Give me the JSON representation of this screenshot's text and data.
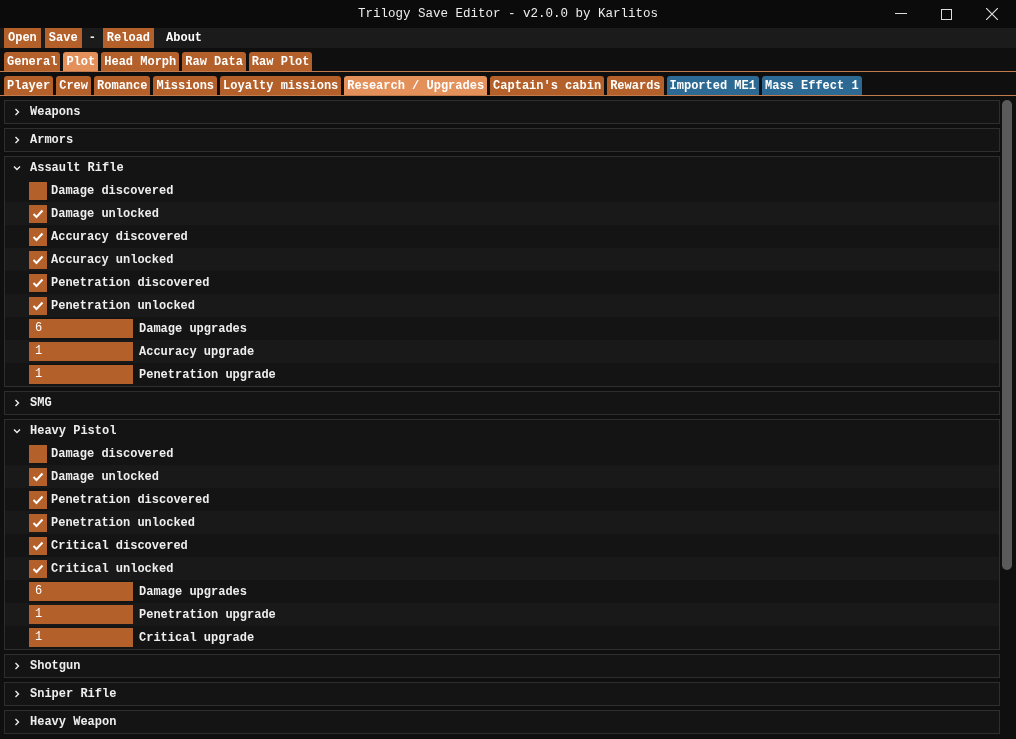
{
  "window": {
    "title": "Trilogy Save Editor - v2.0.0 by Karlitos"
  },
  "menu": [
    {
      "label": "Open",
      "kind": "button"
    },
    {
      "label": "Save",
      "kind": "button"
    },
    {
      "label": "-",
      "kind": "text"
    },
    {
      "label": "Reload",
      "kind": "button"
    },
    {
      "label": "About",
      "kind": "link"
    }
  ],
  "tabs": [
    {
      "label": "General",
      "selected": false
    },
    {
      "label": "Plot",
      "selected": true
    },
    {
      "label": "Head Morph",
      "selected": false
    },
    {
      "label": "Raw Data",
      "selected": false
    },
    {
      "label": "Raw Plot",
      "selected": false
    }
  ],
  "subtabs": [
    {
      "label": "Player",
      "selected": false,
      "kind": "me2"
    },
    {
      "label": "Crew",
      "selected": false,
      "kind": "me2"
    },
    {
      "label": "Romance",
      "selected": false,
      "kind": "me2"
    },
    {
      "label": "Missions",
      "selected": false,
      "kind": "me2"
    },
    {
      "label": "Loyalty missions",
      "selected": false,
      "kind": "me2"
    },
    {
      "label": "Research / Upgrades",
      "selected": true,
      "kind": "me2"
    },
    {
      "label": "Captain's cabin",
      "selected": false,
      "kind": "me2"
    },
    {
      "label": "Rewards",
      "selected": false,
      "kind": "me2"
    },
    {
      "label": "Imported ME1",
      "selected": false,
      "kind": "me1"
    },
    {
      "label": "Mass Effect 1",
      "selected": false,
      "kind": "me1"
    }
  ],
  "sections": [
    {
      "title": "Weapons",
      "expanded": false
    },
    {
      "title": "Armors",
      "expanded": false
    },
    {
      "title": "Assault Rifle",
      "expanded": true,
      "items": [
        {
          "kind": "checkbox",
          "label": "Damage discovered",
          "checked": false
        },
        {
          "kind": "checkbox",
          "label": "Damage unlocked",
          "checked": true
        },
        {
          "kind": "checkbox",
          "label": "Accuracy discovered",
          "checked": true
        },
        {
          "kind": "checkbox",
          "label": "Accuracy unlocked",
          "checked": true
        },
        {
          "kind": "checkbox",
          "label": "Penetration discovered",
          "checked": true
        },
        {
          "kind": "checkbox",
          "label": "Penetration unlocked",
          "checked": true
        },
        {
          "kind": "number",
          "label": "Damage upgrades",
          "amount": "6"
        },
        {
          "kind": "number",
          "label": "Accuracy upgrade",
          "amount": "1"
        },
        {
          "kind": "number",
          "label": "Penetration upgrade",
          "amount": "1"
        }
      ]
    },
    {
      "title": "SMG",
      "expanded": false
    },
    {
      "title": "Heavy Pistol",
      "expanded": true,
      "items": [
        {
          "kind": "checkbox",
          "label": "Damage discovered",
          "checked": false
        },
        {
          "kind": "checkbox",
          "label": "Damage unlocked",
          "checked": true
        },
        {
          "kind": "checkbox",
          "label": "Penetration discovered",
          "checked": true
        },
        {
          "kind": "checkbox",
          "label": "Penetration unlocked",
          "checked": true
        },
        {
          "kind": "checkbox",
          "label": "Critical discovered",
          "checked": true
        },
        {
          "kind": "checkbox",
          "label": "Critical unlocked",
          "checked": true
        },
        {
          "kind": "number",
          "label": "Damage upgrades",
          "amount": "6"
        },
        {
          "kind": "number",
          "label": "Penetration upgrade",
          "amount": "1"
        },
        {
          "kind": "number",
          "label": "Critical upgrade",
          "amount": "1"
        }
      ]
    },
    {
      "title": "Shotgun",
      "expanded": false
    },
    {
      "title": "Sniper Rifle",
      "expanded": false
    },
    {
      "title": "Heavy Weapon",
      "expanded": false
    }
  ]
}
